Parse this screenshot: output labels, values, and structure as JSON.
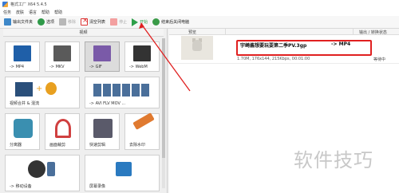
{
  "window": {
    "title": "格式工厂 X64 5.4.5"
  },
  "menu": [
    "任务",
    "皮肤",
    "语言",
    "帮助",
    "帮助"
  ],
  "toolbar": {
    "buttons": [
      {
        "label": "输出文件夹",
        "icon": "folder-icon",
        "enabled": true
      },
      {
        "label": "选项",
        "icon": "options-icon",
        "enabled": true
      },
      {
        "label": "移除",
        "icon": "remove-icon",
        "enabled": false
      },
      {
        "label": "清空列表",
        "icon": "clear-list-icon",
        "enabled": true
      },
      {
        "label": "停止",
        "icon": "stop-icon",
        "enabled": false
      },
      {
        "label": "开始",
        "icon": "play-icon",
        "enabled": true,
        "color": "#2ea04a"
      },
      {
        "label": "结束后关闭电脑",
        "icon": "shutdown-icon",
        "enabled": true
      }
    ]
  },
  "left_panel": {
    "category": "视频",
    "tiles": [
      {
        "label": "-> MP4",
        "icon": "mp4-icon",
        "selected": false
      },
      {
        "label": "-> MKV",
        "icon": "mkv-icon",
        "selected": false
      },
      {
        "label": "-> GIF",
        "icon": "gif-icon",
        "selected": true
      },
      {
        "label": "-> WebM",
        "icon": "webm-icon",
        "selected": false
      },
      {
        "label": "视频合并 & 混流",
        "icon": "video-merge-icon",
        "selected": false
      },
      {
        "label": "-> AVI FLV MOV ...",
        "icon": "multi-format-icon",
        "selected": false
      },
      {
        "label": "分离器",
        "icon": "splitter-icon",
        "selected": false
      },
      {
        "label": "画面裁剪",
        "icon": "crop-icon",
        "selected": false
      },
      {
        "label": "快速剪辑",
        "icon": "quick-clip-icon",
        "selected": false
      },
      {
        "label": "去除水印",
        "icon": "remove-watermark-icon",
        "selected": false
      },
      {
        "label": "-> 移动设备",
        "icon": "mobile-device-icon",
        "selected": false
      },
      {
        "label": "屏幕录像",
        "icon": "screen-record-icon",
        "selected": false
      }
    ]
  },
  "file_list": {
    "columns": {
      "preview": "预览",
      "output": "输出 / 转换状态"
    },
    "rows": [
      {
        "filename": "宇崎酱想要玩耍第二季PV.3gp",
        "target": "-> MP4",
        "info": "1.70M, 176x144, 215Kbps, 00:01:00",
        "status": "等待中"
      }
    ]
  },
  "watermark": "软件技巧"
}
